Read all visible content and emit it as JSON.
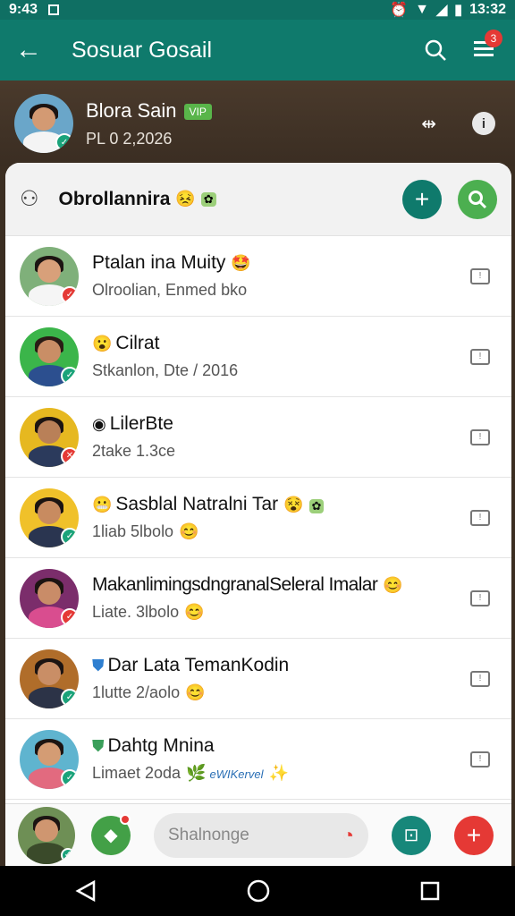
{
  "status": {
    "time": "9:43",
    "right_time": "13:32"
  },
  "appbar": {
    "title": "Sosuar Gosail",
    "notif_count": "3"
  },
  "profile": {
    "name": "Blora Sain",
    "tag": "VIP",
    "sub": "PL 0 2,2026"
  },
  "panel": {
    "title": "Obrollannira"
  },
  "contacts": [
    {
      "name": "Ptalan ina Muity",
      "sub": "Olroolian, Enmed bko",
      "status_color": "#e53935"
    },
    {
      "name": "Cilrat",
      "sub": "Stkanlon, Dte / 2016",
      "status_color": "#1aa37a"
    },
    {
      "name": "LilerBte",
      "sub": "2take 1.3ce",
      "status_color": "#e53935"
    },
    {
      "name": "Sasblal Natralni Tar",
      "sub": "1liab 5lbolo",
      "status_color": "#1aa37a"
    },
    {
      "name": "MakanlimingsdngranalSeleral Imalar",
      "sub": "Liate. 3lbolo",
      "status_color": "#e53935"
    },
    {
      "name": "Dar Lata TemanKodin",
      "sub": "1lutte 2/aolo",
      "status_color": "#1aa37a"
    },
    {
      "name": "Dahtg Mnina",
      "sub": "Limaet 2oda",
      "sub_extra": "eWIKervel",
      "status_color": "#1aa37a"
    }
  ],
  "bottom": {
    "search_placeholder": "Shalnonge"
  },
  "colors": {
    "teal": "#0f7a6c",
    "green": "#4caf50",
    "red": "#e53935"
  }
}
